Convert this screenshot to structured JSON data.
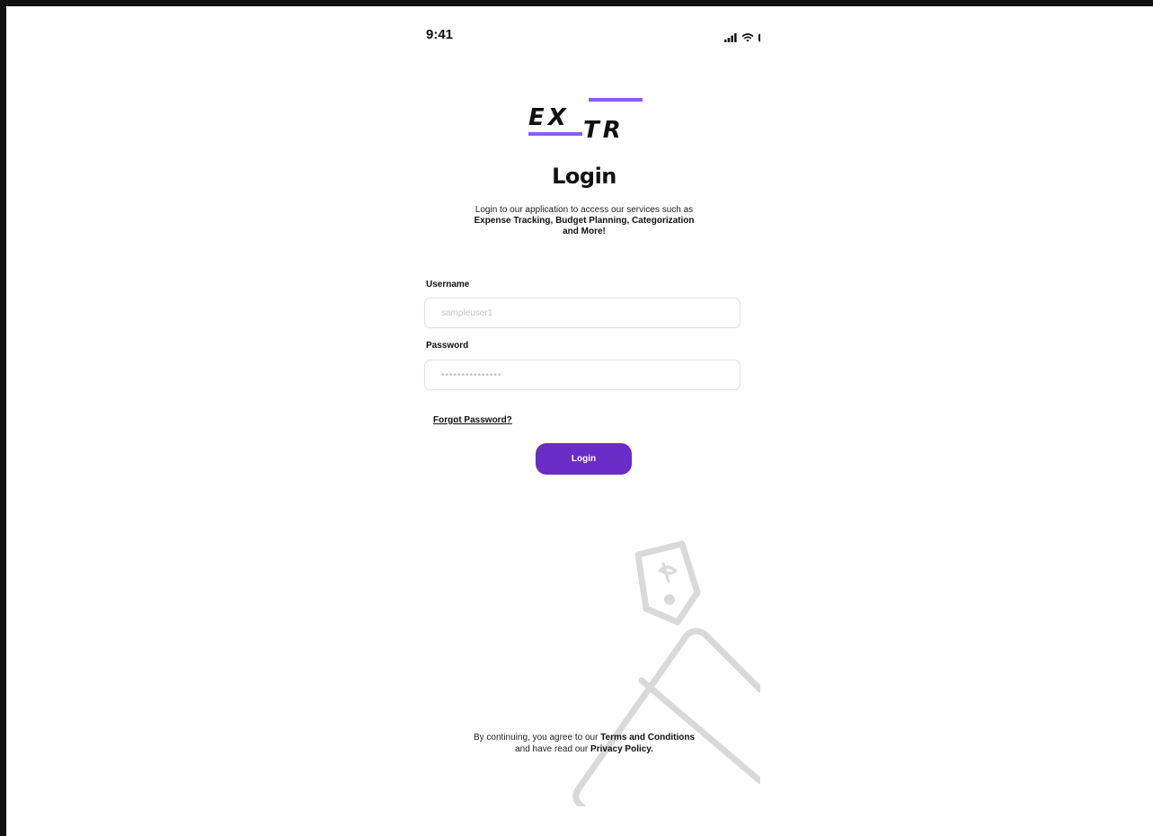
{
  "status_bar": {
    "time": "9:41",
    "icons": [
      "signal-icon",
      "wifi-icon",
      "battery-icon"
    ]
  },
  "logo": {
    "line1": "EX",
    "line2": "TR",
    "accent_color": "#8b5cf6"
  },
  "header": {
    "title": "Login",
    "subtitle_prefix": "Login to our application to access our services such as ",
    "subtitle_bold": "Expense Tracking, Budget Planning, Categorization and More!"
  },
  "form": {
    "username_label": "Username",
    "username_placeholder": "sampleuser1",
    "username_value": "",
    "password_label": "Password",
    "password_placeholder": "•••••••••••••••",
    "password_value": "",
    "forgot_label": "Forgot Password?",
    "login_label": "Login",
    "button_color": "#6a2cc6"
  },
  "footer": {
    "text_1": "By continuing, you agree to our ",
    "link_terms": "Terms and Conditions",
    "text_2": " and have read our ",
    "link_privacy": "Privacy Policy."
  }
}
